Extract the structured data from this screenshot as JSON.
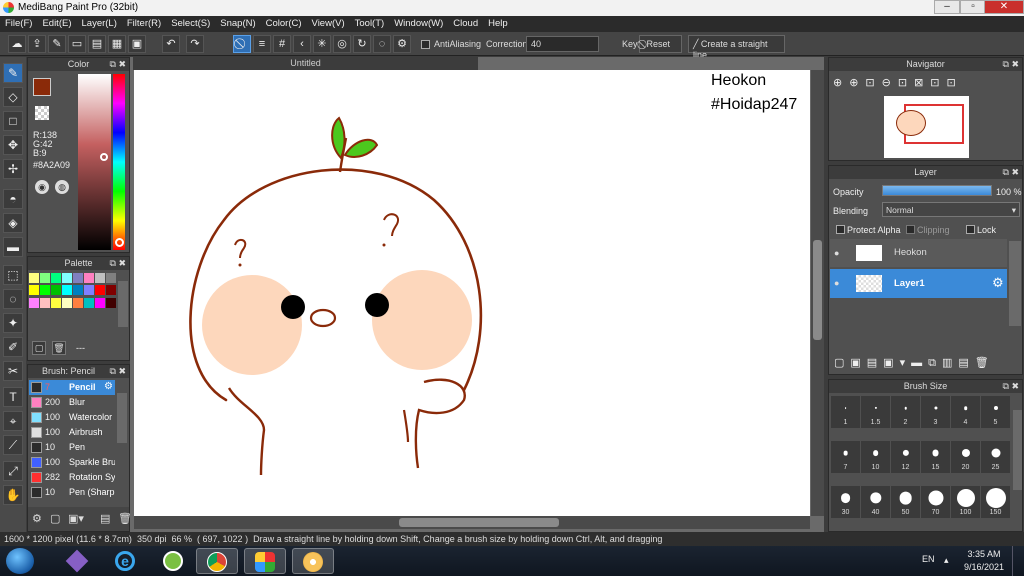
{
  "window": {
    "title": "MediBang Paint Pro (32bit)"
  },
  "menu": [
    "File(F)",
    "Edit(E)",
    "Layer(L)",
    "Filter(R)",
    "Select(S)",
    "Snap(N)",
    "Color(C)",
    "View(V)",
    "Tool(T)",
    "Window(W)",
    "Cloud",
    "Help"
  ],
  "toolbar": {
    "antialiasing_label": "AntiAliasing",
    "correction_label": "Correction",
    "correction_value": "40",
    "key_label": "Key",
    "reset_label": "Reset",
    "straight_line_label": "Create a straight line"
  },
  "color_panel": {
    "title": "Color",
    "r": "R:138",
    "g": "G:42",
    "b": "B:9",
    "hex": "#8A2A09",
    "color": "#8A2A09"
  },
  "palette_panel": {
    "title": "Palette",
    "swatches": [
      "#ffff80",
      "#80ff80",
      "#00ff80",
      "#80ffff",
      "#8080c0",
      "#ff80c0",
      "#c0c0c0",
      "#808080",
      "#ffff00",
      "#00ff00",
      "#00c000",
      "#00ffff",
      "#0080c0",
      "#8080ff",
      "#ff0000",
      "#800000",
      "#ff80ff",
      "#ffc0c0",
      "#ffff40",
      "#ffffc0",
      "#ff8040",
      "#00c0c0",
      "#ff00ff",
      "#400000"
    ],
    "dash": "---"
  },
  "brush_panel": {
    "title": "Brush: Pencil",
    "items": [
      {
        "size": "7",
        "name": "Pencil",
        "color": "#2a2a2a"
      },
      {
        "size": "200",
        "name": "Blur",
        "color": "#ff80c0"
      },
      {
        "size": "100",
        "name": "Watercolor",
        "color": "#80e0ff"
      },
      {
        "size": "100",
        "name": "Airbrush",
        "color": "#e0e0e0"
      },
      {
        "size": "10",
        "name": "Pen",
        "color": "#2a2a2a"
      },
      {
        "size": "100",
        "name": "Sparkle Bru",
        "color": "#4060ff"
      },
      {
        "size": "282",
        "name": "Rotation Sy",
        "color": "#ff3030"
      },
      {
        "size": "10",
        "name": "Pen (Sharp",
        "color": "#2a2a2a"
      }
    ]
  },
  "canvas": {
    "tab_title": "Untitled",
    "text_line1": "Heokon",
    "text_line2": "#Hoidap247",
    "drawing": {
      "cheek_color": "#fdd7bc",
      "line_color": "#8a2a09",
      "leaf_color": "#4cc81e"
    }
  },
  "navigator_panel": {
    "title": "Navigator"
  },
  "layer_panel": {
    "title": "Layer",
    "opacity_label": "Opacity",
    "opacity_value": "100 %",
    "opacity_fraction": 1.0,
    "blending_label": "Blending",
    "blending_value": "Normal",
    "protect_alpha_label": "Protect Alpha",
    "clipping_label": "Clipping",
    "lock_label": "Lock",
    "layers": [
      {
        "name": "Heokon",
        "selected": false
      },
      {
        "name": "Layer1",
        "selected": true
      }
    ]
  },
  "brush_size_panel": {
    "title": "Brush Size",
    "sizes": [
      "1",
      "1.5",
      "2",
      "3",
      "4",
      "5",
      "7",
      "10",
      "12",
      "15",
      "20",
      "25",
      "30",
      "40",
      "50",
      "70",
      "100",
      "150"
    ]
  },
  "statusbar": {
    "canvas_size": "1600 * 1200 pixel",
    "print_size": "(11.6 * 8.7cm)",
    "dpi": "350 dpi",
    "zoom": "66 %",
    "coords": "( 697, 1022 )",
    "hint": "Draw a straight line by holding down Shift, Change a brush size by holding down Ctrl, Alt, and dragging"
  },
  "taskbar": {
    "lang": "EN",
    "time": "3:35 AM",
    "date": "9/16/2021"
  }
}
